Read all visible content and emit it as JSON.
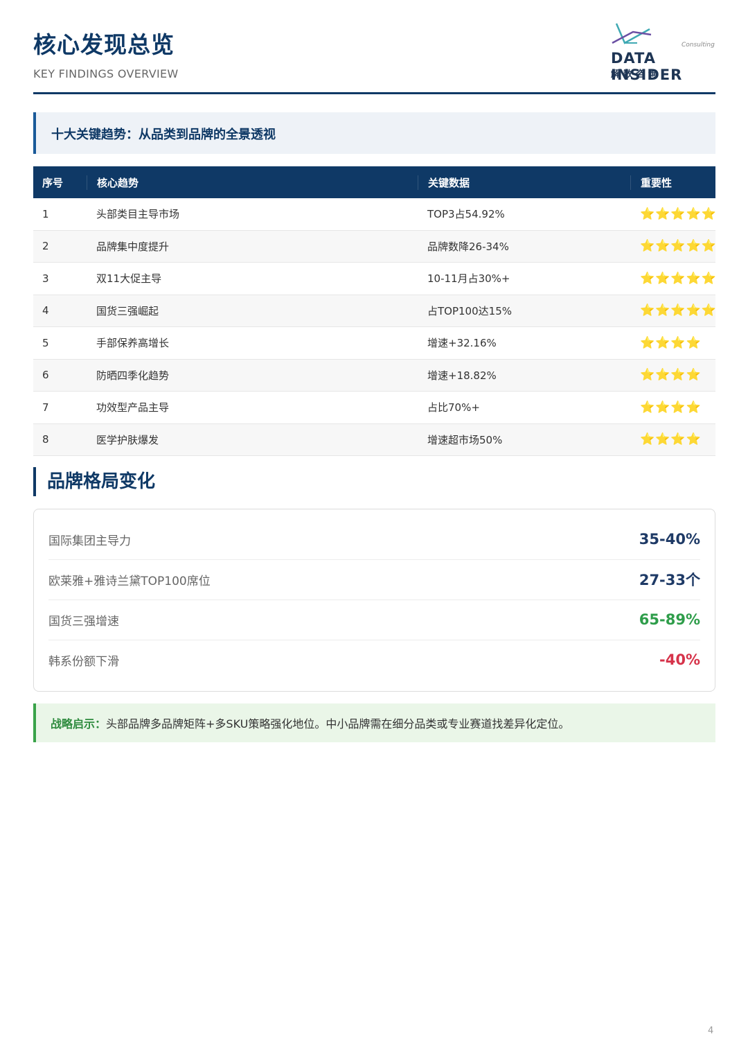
{
  "header": {
    "title": "核心发现总览",
    "subtitle": "KEY FINDINGS OVERVIEW",
    "logo": {
      "consulting": "Consulting",
      "name": "DATA INSIDER",
      "cn": "解数咨询",
      "accent_colors": [
        "#3fa9b3",
        "#6a4fa3"
      ]
    }
  },
  "banner": {
    "text": "十大关键趋势：从品类到品牌的全景透视"
  },
  "table": {
    "headers": [
      "序号",
      "核心趋势",
      "关键数据",
      "重要性"
    ],
    "rows": [
      {
        "no": "1",
        "trend": "头部类目主导市场",
        "data": "TOP3占54.92%",
        "stars": "⭐⭐⭐⭐⭐"
      },
      {
        "no": "2",
        "trend": "品牌集中度提升",
        "data": "品牌数降26-34%",
        "stars": "⭐⭐⭐⭐⭐"
      },
      {
        "no": "3",
        "trend": "双11大促主导",
        "data": "10-11月占30%+",
        "stars": "⭐⭐⭐⭐⭐"
      },
      {
        "no": "4",
        "trend": "国货三强崛起",
        "data": "占TOP100达15%",
        "stars": "⭐⭐⭐⭐⭐"
      },
      {
        "no": "5",
        "trend": "手部保养高增长",
        "data": "增速+32.16%",
        "stars": "⭐⭐⭐⭐"
      },
      {
        "no": "6",
        "trend": "防晒四季化趋势",
        "data": "增速+18.82%",
        "stars": "⭐⭐⭐⭐"
      },
      {
        "no": "7",
        "trend": "功效型产品主导",
        "data": "占比70%+",
        "stars": "⭐⭐⭐⭐"
      },
      {
        "no": "8",
        "trend": "医学护肤爆发",
        "data": "增速超市场50%",
        "stars": "⭐⭐⭐⭐"
      }
    ]
  },
  "section2": {
    "title": "品牌格局变化"
  },
  "brand_card": {
    "rows": [
      {
        "label": "国际集团主导力",
        "value": "35-40%",
        "color": "#1e3a66"
      },
      {
        "label": "欧莱雅+雅诗兰黛TOP100席位",
        "value": "27-33个",
        "color": "#1e3a66"
      },
      {
        "label": "国货三强增速",
        "value": "65-89%",
        "color": "#2e9d4a"
      },
      {
        "label": "韩系份额下滑",
        "value": "-40%",
        "color": "#d6334a"
      }
    ]
  },
  "insight": {
    "key": "战略启示：",
    "text": "头部品牌多品牌矩阵+多SKU策略强化地位。中小品牌需在细分品类或专业赛道找差异化定位。"
  },
  "page_number": "4"
}
